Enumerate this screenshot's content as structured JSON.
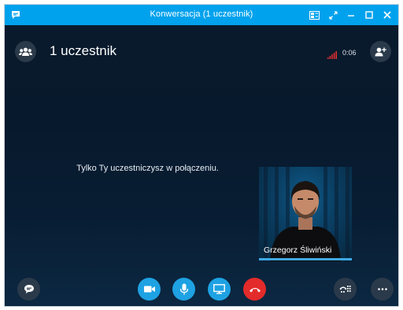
{
  "window": {
    "title": "Konwersacja (1 uczestnik)"
  },
  "header": {
    "participants_label": "1 uczestnik",
    "call_timer": "0:06"
  },
  "main": {
    "status_message": "Tylko Ty uczestniczysz w połączeniu."
  },
  "self_video": {
    "name": "Grzegorz Śliwiński"
  },
  "colors": {
    "titlebar": "#00a2ed",
    "call_button_blue": "#1ea2e3",
    "hangup_red": "#e32b2b",
    "signal_red": "#e03030",
    "dark_button": "#2b3a4a"
  },
  "icons": {
    "titlebar": [
      "skype-logo-icon",
      "compact-view-icon",
      "full-screen-icon",
      "minimize-icon",
      "maximize-icon",
      "close-icon"
    ],
    "header": [
      "participants-icon",
      "signal-strength-icon",
      "add-participant-icon"
    ],
    "controls": [
      "chat-icon",
      "video-camera-icon",
      "microphone-icon",
      "share-screen-icon",
      "hang-up-icon",
      "dialpad-icon",
      "more-options-icon"
    ]
  }
}
